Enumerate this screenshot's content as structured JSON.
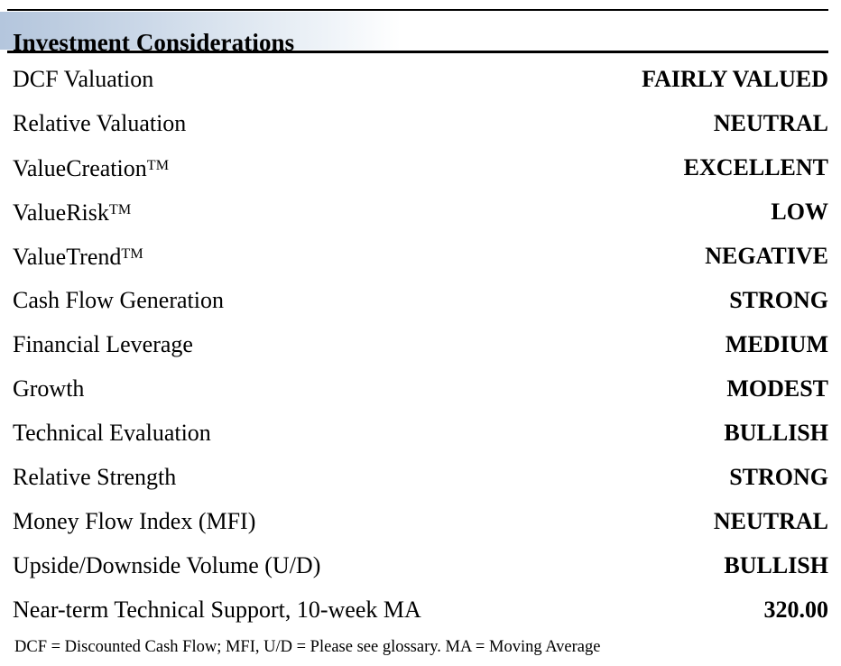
{
  "report": {
    "header_title": "Investment Considerations",
    "accent_color": "#b4c6dd",
    "rule_color": "#000000",
    "text_color": "#000000",
    "background_color": "#ffffff"
  },
  "rows": [
    {
      "label": "DCF Valuation",
      "value": "FAIRLY VALUED"
    },
    {
      "label": "Relative Valuation",
      "value": "NEUTRAL"
    },
    {
      "label": "ValueCreation",
      "tm": true,
      "value": "EXCELLENT"
    },
    {
      "label": "ValueRisk",
      "tm": true,
      "value": "LOW"
    },
    {
      "label": "ValueTrend",
      "tm": true,
      "value": "NEGATIVE"
    },
    {
      "label": "Cash Flow Generation",
      "value": "STRONG"
    },
    {
      "label": "Financial Leverage",
      "value": "MEDIUM"
    },
    {
      "label": "Growth",
      "value": "MODEST"
    },
    {
      "label": "Technical Evaluation",
      "value": "BULLISH"
    },
    {
      "label": "Relative Strength",
      "value": "STRONG"
    },
    {
      "label": "Money Flow Index (MFI)",
      "value": "NEUTRAL"
    },
    {
      "label": "Upside/Downside Volume (U/D)",
      "value": "BULLISH"
    },
    {
      "label": "Near-term Technical Support, 10-week MA",
      "value": "320.00"
    }
  ],
  "footnote": {
    "text": "DCF = Discounted Cash Flow; MFI, U/D = Please see glossary. MA = Moving Average"
  },
  "glyphs": {
    "trademark": "TM"
  }
}
